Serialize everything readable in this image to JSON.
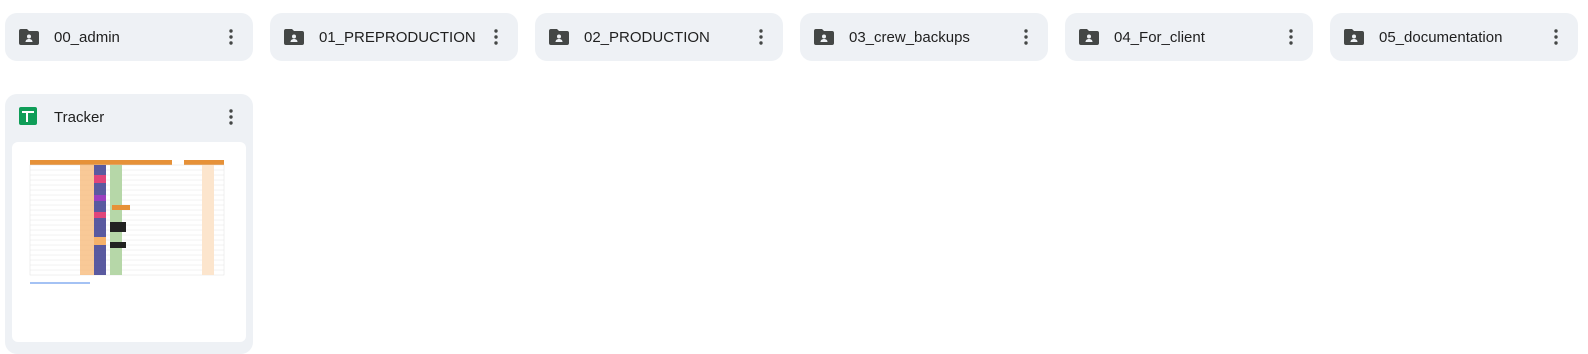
{
  "folders": [
    {
      "name": "00_admin",
      "icon": "shared-folder-icon"
    },
    {
      "name": "01_PREPRODUCTION",
      "icon": "shared-folder-icon"
    },
    {
      "name": "02_PRODUCTION",
      "icon": "shared-folder-icon"
    },
    {
      "name": "03_crew_backups",
      "icon": "shared-folder-icon"
    },
    {
      "name": "04_For_client",
      "icon": "shared-folder-icon"
    },
    {
      "name": "05_documentation",
      "icon": "shared-folder-icon"
    }
  ],
  "files": [
    {
      "name": "Tracker",
      "icon": "google-sheets-icon"
    }
  ],
  "colors": {
    "card_bg": "#eef1f5",
    "text": "#1f1f1f",
    "icon": "#444746",
    "sheets_green": "#0f9d58",
    "header_orange": "#e69138"
  }
}
